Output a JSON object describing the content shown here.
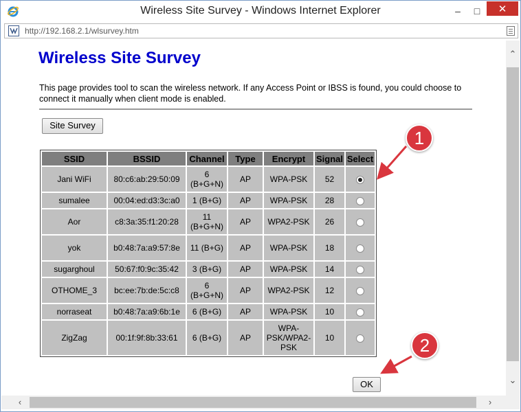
{
  "window": {
    "title": "Wireless Site Survey - Windows Internet Explorer",
    "minimize": "–",
    "maximize": "□",
    "close": "✕"
  },
  "address": {
    "url": "http://192.168.2.1/wlsurvey.htm"
  },
  "page": {
    "heading": "Wireless Site Survey",
    "description": "This page provides tool to scan the wireless network. If any Access Point or IBSS is found, you could choose to connect it manually when client mode is enabled.",
    "survey_button": "Site Survey",
    "ok_button": "OK"
  },
  "table": {
    "headers": [
      "SSID",
      "BSSID",
      "Channel",
      "Type",
      "Encrypt",
      "Signal",
      "Select"
    ],
    "rows": [
      {
        "ssid": "Jani WiFi",
        "bssid": "80:c6:ab:29:50:09",
        "channel": "6 (B+G+N)",
        "type": "AP",
        "encrypt": "WPA-PSK",
        "signal": "52",
        "selected": true
      },
      {
        "ssid": "sumalee",
        "bssid": "00:04:ed:d3:3c:a0",
        "channel": "1 (B+G)",
        "type": "AP",
        "encrypt": "WPA-PSK",
        "signal": "28",
        "selected": false
      },
      {
        "ssid": "Aor",
        "bssid": "c8:3a:35:f1:20:28",
        "channel": "11 (B+G+N)",
        "type": "AP",
        "encrypt": "WPA2-PSK",
        "signal": "26",
        "selected": false
      },
      {
        "ssid": "yok",
        "bssid": "b0:48:7a:a9:57:8e",
        "channel": "11 (B+G)",
        "type": "AP",
        "encrypt": "WPA-PSK",
        "signal": "18",
        "selected": false
      },
      {
        "ssid": "sugarghoul",
        "bssid": "50:67:f0:9c:35:42",
        "channel": "3 (B+G)",
        "type": "AP",
        "encrypt": "WPA-PSK",
        "signal": "14",
        "selected": false
      },
      {
        "ssid": "OTHOME_3",
        "bssid": "bc:ee:7b:de:5c:c8",
        "channel": "6 (B+G+N)",
        "type": "AP",
        "encrypt": "WPA2-PSK",
        "signal": "12",
        "selected": false
      },
      {
        "ssid": "norraseat",
        "bssid": "b0:48:7a:a9:6b:1e",
        "channel": "6 (B+G)",
        "type": "AP",
        "encrypt": "WPA-PSK",
        "signal": "10",
        "selected": false
      },
      {
        "ssid": "ZigZag",
        "bssid": "00:1f:9f:8b:33:61",
        "channel": "6 (B+G)",
        "type": "AP",
        "encrypt": "WPA-PSK/WPA2-PSK",
        "signal": "10",
        "selected": false
      }
    ]
  },
  "annotations": {
    "step1": "1",
    "step2": "2"
  },
  "colors": {
    "heading": "#0000cc",
    "annotation": "#d9363e",
    "close_button": "#c7312b"
  }
}
